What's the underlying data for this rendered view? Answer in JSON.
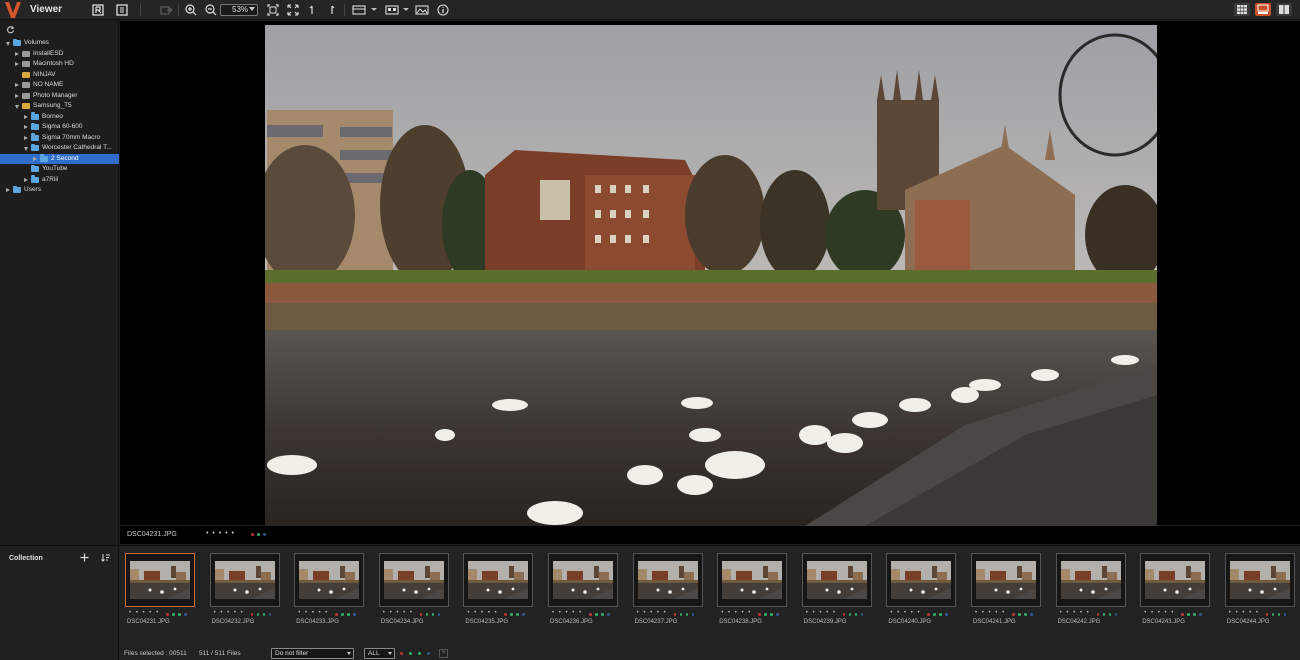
{
  "app": {
    "title": "Viewer",
    "zoom": "53%"
  },
  "colors": {
    "accent": "#c7502a",
    "selection": "#2f6ecb",
    "folder": "#5ba6de"
  },
  "toolbar_icons": [
    "import-icon",
    "export-icon",
    "zoom-in-icon",
    "zoom-out-icon",
    "fit-icon",
    "fullscreen-icon",
    "rotate-icon",
    "compare-icon",
    "layout-icon",
    "image-icon",
    "info-icon"
  ],
  "tree": [
    {
      "label": "Volumes",
      "level": 0,
      "expanded": true,
      "kind": "folder"
    },
    {
      "label": "InstallESD",
      "level": 1,
      "expanded": false,
      "kind": "drive-gray"
    },
    {
      "label": "Macintosh HD",
      "level": 1,
      "expanded": false,
      "kind": "drive-gray"
    },
    {
      "label": "NINJAV",
      "level": 1,
      "expanded": null,
      "kind": "drive-yellow"
    },
    {
      "label": "NO NAME",
      "level": 1,
      "expanded": false,
      "kind": "drive-gray"
    },
    {
      "label": "Photo Manager",
      "level": 1,
      "expanded": false,
      "kind": "drive-gray"
    },
    {
      "label": "Samsung_T5",
      "level": 1,
      "expanded": true,
      "kind": "drive-yellow"
    },
    {
      "label": "Borneo",
      "level": 2,
      "expanded": false,
      "kind": "folder"
    },
    {
      "label": "Sigma 60-600",
      "level": 2,
      "expanded": false,
      "kind": "folder"
    },
    {
      "label": "Sigma 70mm Macro",
      "level": 2,
      "expanded": false,
      "kind": "folder"
    },
    {
      "label": "Worcester Cathedral T...",
      "level": 2,
      "expanded": true,
      "kind": "folder"
    },
    {
      "label": "2 Second",
      "level": 3,
      "expanded": false,
      "kind": "folder",
      "selected": true
    },
    {
      "label": "YouTube",
      "level": 2,
      "expanded": null,
      "kind": "folder"
    },
    {
      "label": "a7Riii",
      "level": 2,
      "expanded": false,
      "kind": "folder"
    },
    {
      "label": "Users",
      "level": 0,
      "expanded": false,
      "kind": "folder"
    }
  ],
  "viewer": {
    "filename": "DSC04231.JPG",
    "stars": "• • • • •"
  },
  "collection": {
    "label": "Collection"
  },
  "thumbnails": [
    {
      "name": "DSC04231.JPG",
      "selected": true
    },
    {
      "name": "DSC04232.JPG"
    },
    {
      "name": "DSC04233.JPG"
    },
    {
      "name": "DSC04234.JPG"
    },
    {
      "name": "DSC04235.JPG"
    },
    {
      "name": "DSC04236.JPG"
    },
    {
      "name": "DSC04237.JPG"
    },
    {
      "name": "DSC04238.JPG"
    },
    {
      "name": "DSC04239.JPG"
    },
    {
      "name": "DSC04240.JPG"
    },
    {
      "name": "DSC04241.JPG"
    },
    {
      "name": "DSC04242.JPG"
    },
    {
      "name": "DSC04243.JPG"
    },
    {
      "name": "DSC04244.JPG"
    }
  ],
  "status": {
    "selected": "Files selected : 00511",
    "count": "511 / 511 Files",
    "filter": "Do not filter",
    "rating_filter": "ALL",
    "clear": "×"
  }
}
